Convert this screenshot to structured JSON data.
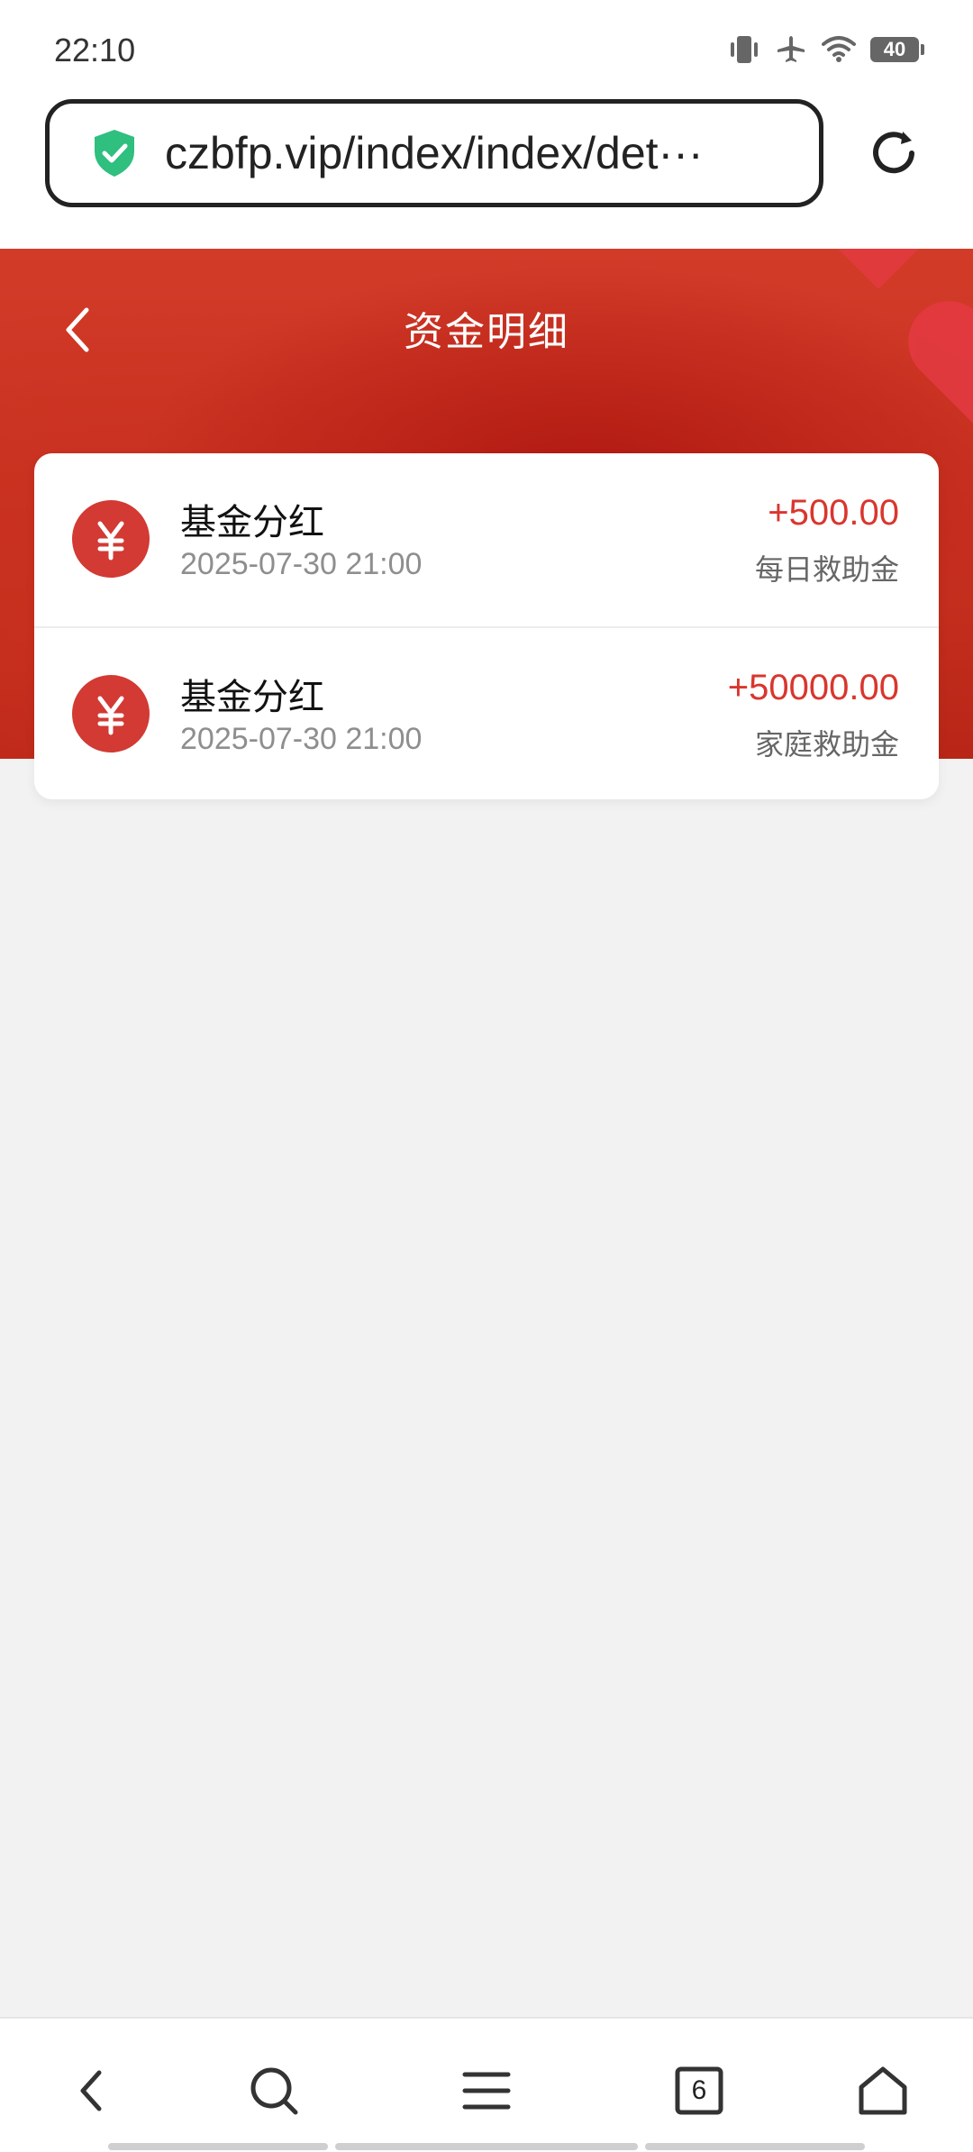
{
  "status_bar": {
    "time": "22:10",
    "battery": "40",
    "icons": [
      "vibrate-icon",
      "airplane-icon",
      "wifi-icon",
      "battery-icon"
    ]
  },
  "browser": {
    "url": "czbfp.vip/index/index/det···",
    "icons": [
      "shield-check-icon",
      "reload-icon"
    ]
  },
  "header": {
    "title": "资金明细",
    "icons": [
      "back-icon"
    ]
  },
  "transactions": [
    {
      "title": "基金分红",
      "time": "2025-07-30 21:00",
      "amount": "+500.00",
      "tag": "每日救助金"
    },
    {
      "title": "基金分红",
      "time": "2025-07-30 21:00",
      "amount": "+50000.00",
      "tag": "家庭救助金"
    }
  ],
  "bottom_nav": {
    "tabs_count": "6",
    "icons": [
      "nav-back-icon",
      "nav-search-icon",
      "nav-menu-icon",
      "nav-tabs-icon",
      "nav-home-icon"
    ]
  },
  "colors": {
    "accent_red": "#d9362e",
    "banner_red": "#c7301f",
    "shield_green": "#2fbf7f"
  }
}
